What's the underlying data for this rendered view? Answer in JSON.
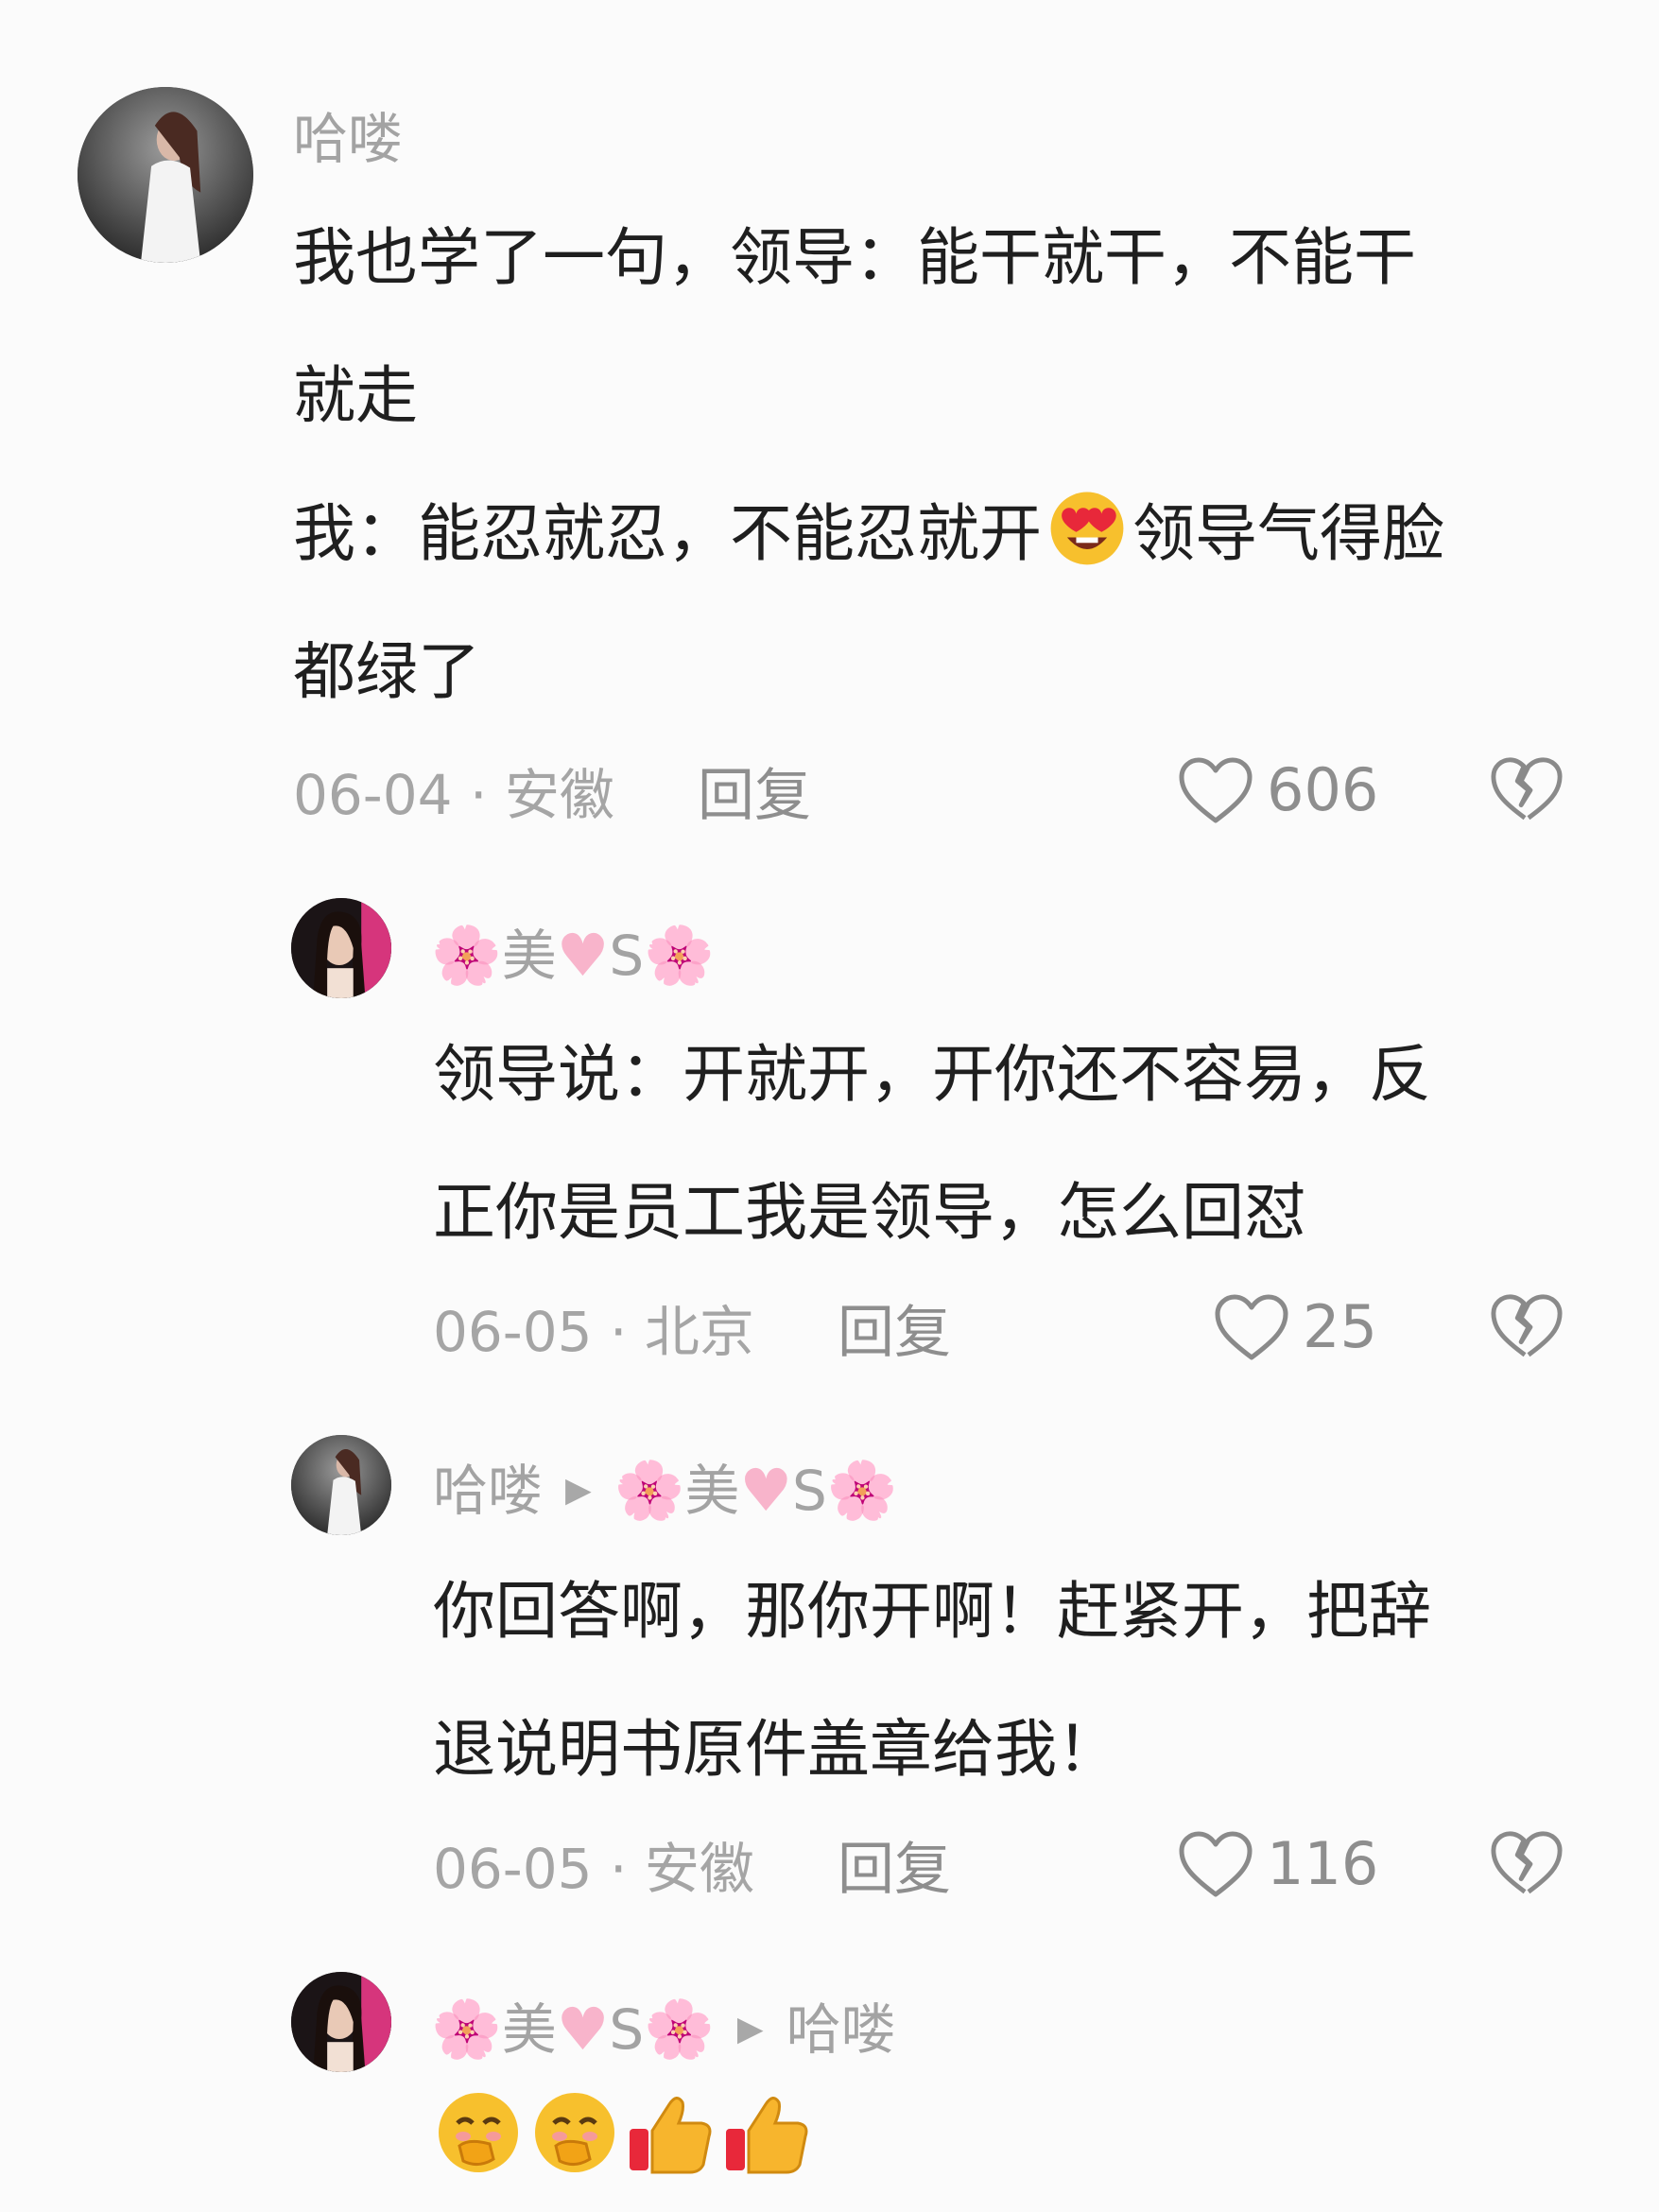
{
  "comments": [
    {
      "user": "哈喽",
      "text_line1": "我也学了一句，领导：能干就干，不能干",
      "text_line2": "就走",
      "text_line3a": "我：能忍就忍，不能忍就开",
      "text_line3b": "领导气得脸",
      "text_line4": "都绿了",
      "meta": "06-04 · 安徽",
      "reply": "回复",
      "likes": "606"
    },
    {
      "user_parts": [
        "🌸",
        "美",
        "♥",
        "S",
        "🌸"
      ],
      "text_line1": "领导说：开就开，开你还不容易，反",
      "text_line2": "正你是员工我是领导，怎么回怼",
      "meta": "06-05 · 北京",
      "reply": "回复",
      "likes": "25"
    },
    {
      "user": "哈喽",
      "arrow": "▶",
      "reply_to_parts": [
        "🌸",
        "美",
        "♥",
        "S",
        "🌸"
      ],
      "text_line1": "你回答啊，那你开啊！赶紧开，把辞",
      "text_line2": "退说明书原件盖章给我！",
      "meta": "06-05 · 安徽",
      "reply": "回复",
      "likes": "116"
    },
    {
      "user_parts": [
        "🌸",
        "美",
        "♥",
        "S",
        "🌸"
      ],
      "arrow": "▶",
      "reply_to": "哈喽",
      "emojis": [
        "hand-over-mouth-icon",
        "hand-over-mouth-icon",
        "thumbs-up-icon",
        "thumbs-up-icon"
      ]
    }
  ]
}
